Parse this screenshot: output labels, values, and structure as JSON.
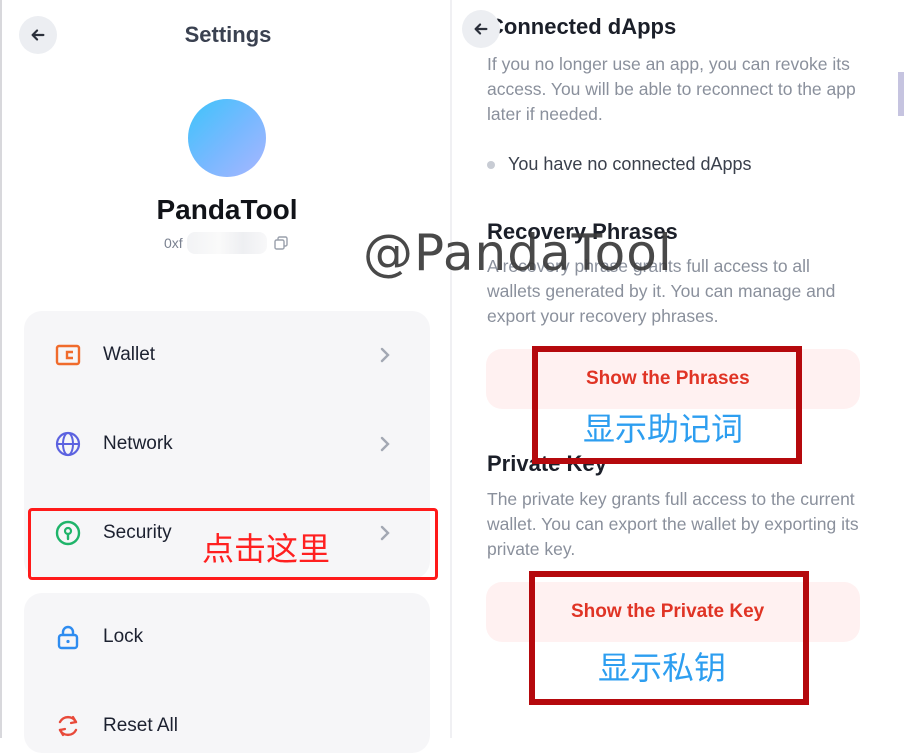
{
  "settings": {
    "title": "Settings",
    "account_name": "PandaTool",
    "address_prefix": "0xf",
    "menu": [
      {
        "label": "Wallet",
        "icon": "wallet-icon"
      },
      {
        "label": "Network",
        "icon": "globe-icon"
      },
      {
        "label": "Security",
        "icon": "security-lock-icon"
      },
      {
        "label": "Lock",
        "icon": "lock-icon"
      },
      {
        "label": "Reset All",
        "icon": "reset-icon"
      }
    ],
    "annotation": "点击这里"
  },
  "security": {
    "connected_title": "Connected dApps",
    "connected_desc": "If you no longer use an app, you can revoke its access. You will be able to reconnect to the app later if needed.",
    "no_dapps": "You have no connected dApps",
    "recovery_title": "Recovery Phrases",
    "recovery_desc": "A recovery phrase grants full access to all wallets generated by it. You can manage and export your recovery phrases.",
    "show_phrases_label": "Show the Phrases",
    "phrases_annotation": "显示助记词",
    "private_key_title": "Private Key",
    "private_key_desc": "The private key grants full access to the current wallet. You can export the wallet by exporting its private key.",
    "show_private_key_label": "Show the Private Key",
    "private_key_annotation": "显示私钥"
  },
  "watermark": "@PandaTool",
  "colors": {
    "accent_red": "#e03425",
    "annotation_red": "#ff1a1a",
    "annotation_box": "#b5090d",
    "annotation_blue": "#2d9ef0",
    "button_bg": "#fff1f1"
  }
}
